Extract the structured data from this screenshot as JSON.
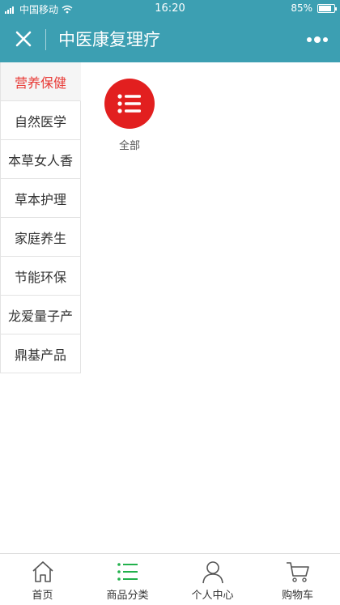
{
  "status_bar": {
    "carrier": "中国移动",
    "time": "16:20",
    "battery": "85%",
    "battery_level": 0.85
  },
  "navbar": {
    "title": "中医康复理疗",
    "close_icon": "close-icon",
    "more_icon": "more-dots-icon"
  },
  "sidebar": {
    "items": [
      {
        "label": "营养保健",
        "active": true
      },
      {
        "label": "自然医学",
        "active": false
      },
      {
        "label": "本草女人香",
        "active": false
      },
      {
        "label": "草本护理",
        "active": false
      },
      {
        "label": "家庭养生",
        "active": false
      },
      {
        "label": "节能环保",
        "active": false
      },
      {
        "label": "龙爱量子产",
        "active": false
      },
      {
        "label": "鼎基产品",
        "active": false
      }
    ]
  },
  "content": {
    "categories": [
      {
        "label": "全部",
        "icon": "list-icon"
      }
    ]
  },
  "tabbar": {
    "items": [
      {
        "label": "首页",
        "icon": "home-icon"
      },
      {
        "label": "商品分类",
        "icon": "category-list-icon",
        "active": true
      },
      {
        "label": "个人中心",
        "icon": "person-icon"
      },
      {
        "label": "购物车",
        "icon": "cart-icon"
      }
    ]
  },
  "colors": {
    "header": "#3c9fb2",
    "active_text": "#e83a36",
    "category_circle": "#e21f1f",
    "tab_active_icon": "#22b14c"
  }
}
